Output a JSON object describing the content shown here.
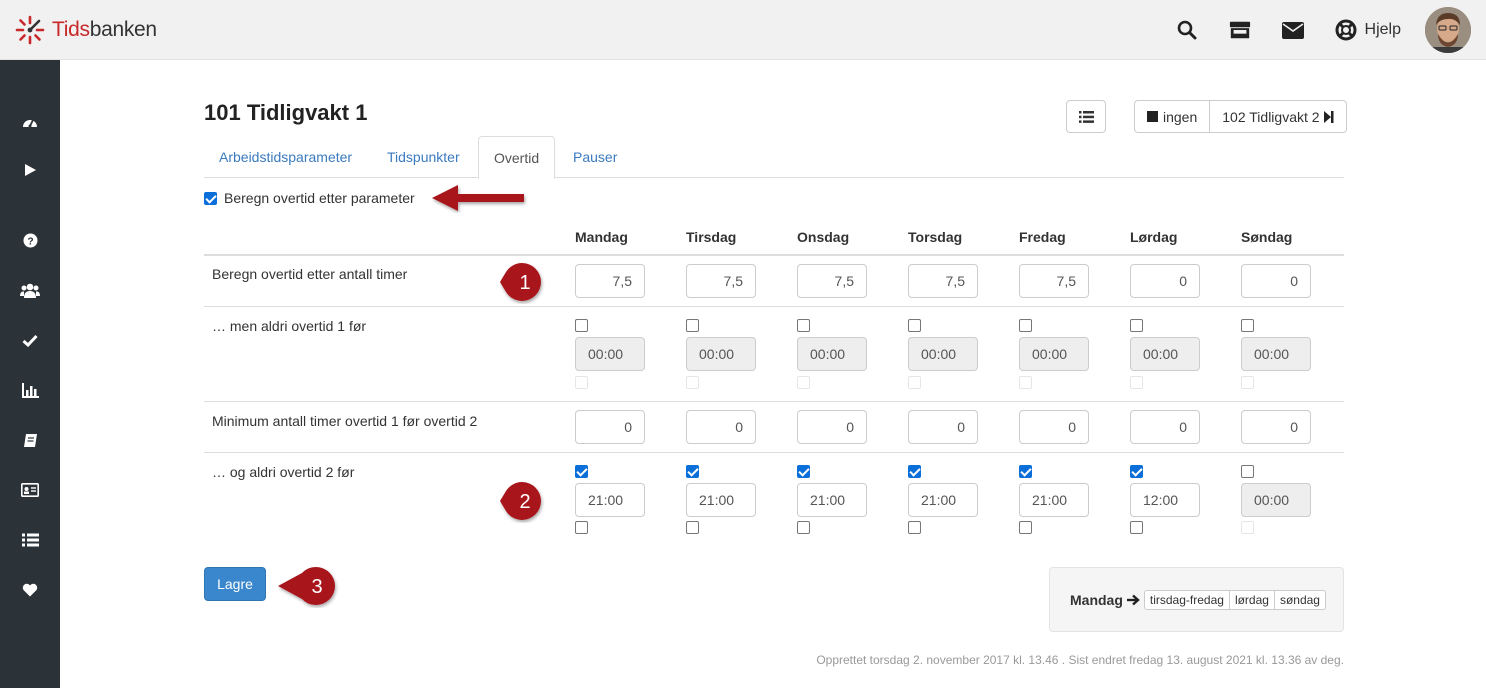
{
  "app": {
    "brand_first": "Tids",
    "brand_second": "banken",
    "help_label": "Hjelp"
  },
  "top_icons": [
    "search-icon",
    "store-icon",
    "mail-icon",
    "lifebuoy-icon"
  ],
  "sidebar": {
    "items": [
      "dashboard-icon",
      "play-icon",
      "help-icon",
      "users-icon",
      "check-icon",
      "chart-icon",
      "book-icon",
      "id-card-icon",
      "list-icon",
      "heart-icon"
    ]
  },
  "page": {
    "title": "101 Tidligvakt 1",
    "nav_prev_label": "ingen",
    "nav_next_label": "102 Tidligvakt 2"
  },
  "tabs": [
    {
      "label": "Arbeidstidsparameter",
      "active": false
    },
    {
      "label": "Tidspunkter",
      "active": false
    },
    {
      "label": "Overtid",
      "active": true
    },
    {
      "label": "Pauser",
      "active": false
    }
  ],
  "main_checkbox": {
    "label": "Beregn overtid etter parameter",
    "checked": true
  },
  "days": [
    "Mandag",
    "Tirsdag",
    "Onsdag",
    "Torsdag",
    "Fredag",
    "Lørdag",
    "Søndag"
  ],
  "rows": {
    "hours": {
      "label": "Beregn overtid etter antall timer",
      "values": [
        "7,5",
        "7,5",
        "7,5",
        "7,5",
        "7,5",
        "0",
        "0"
      ]
    },
    "ot1_before": {
      "label": "… men aldri overtid 1 før",
      "checked": [
        false,
        false,
        false,
        false,
        false,
        false,
        false
      ],
      "values": [
        "00:00",
        "00:00",
        "00:00",
        "00:00",
        "00:00",
        "00:00",
        "00:00"
      ]
    },
    "min_hours": {
      "label": "Minimum antall timer overtid 1 før overtid 2",
      "values": [
        "0",
        "0",
        "0",
        "0",
        "0",
        "0",
        "0"
      ]
    },
    "ot2_before": {
      "label": "… og aldri overtid 2 før",
      "checked": [
        true,
        true,
        true,
        true,
        true,
        true,
        false
      ],
      "values": [
        "21:00",
        "21:00",
        "21:00",
        "21:00",
        "21:00",
        "12:00",
        "00:00"
      ],
      "enabled": [
        true,
        true,
        true,
        true,
        true,
        true,
        false
      ]
    }
  },
  "save_label": "Lagre",
  "copy": {
    "source_label": "Mandag",
    "targets": [
      "tirsdag-fredag",
      "lørdag",
      "søndag"
    ]
  },
  "footer": "Opprettet torsdag 2. november 2017 kl. 13.46 . Sist endret fredag 13. august 2021 kl. 13.36 av deg.",
  "annotations": [
    "1",
    "2",
    "3"
  ],
  "colors": {
    "brand_red": "#c8282a",
    "link_blue": "#3a7bbf",
    "primary_button": "#3a87cd",
    "sidebar_bg": "#2c3338",
    "marker_red": "#a8161c",
    "checkbox_blue": "#0b6fd9"
  }
}
